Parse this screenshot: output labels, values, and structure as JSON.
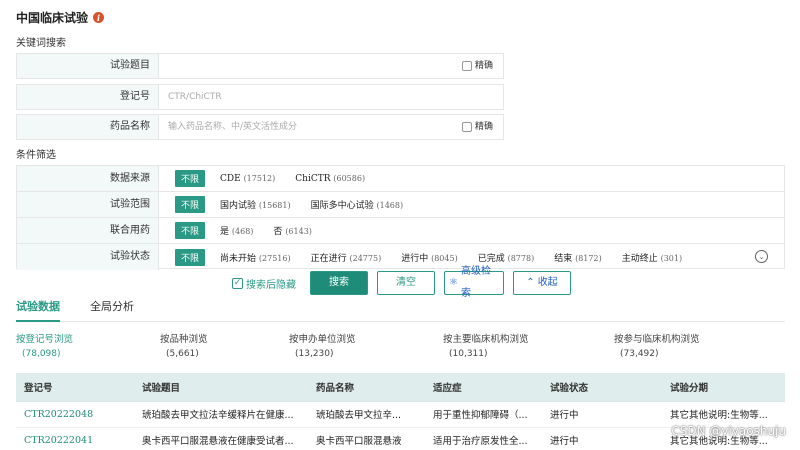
{
  "page": {
    "title": "中国临床试验",
    "info_icon": "i"
  },
  "keyword_section": {
    "label": "关键词搜索",
    "fields": [
      {
        "label": "试验题目",
        "placeholder": "",
        "precise_label": "精确"
      },
      {
        "label": "登记号",
        "placeholder": "CTR/ChiCTR"
      },
      {
        "label": "药品名称",
        "placeholder": "输入药品名称、中/英文活性成分",
        "precise_label": "精确"
      }
    ]
  },
  "filter_section": {
    "label": "条件筛选",
    "all_label": "不限",
    "rows": [
      {
        "label": "数据来源",
        "options": [
          {
            "name": "CDE",
            "count": "(17512)"
          },
          {
            "name": "ChiCTR",
            "count": "(60586)"
          }
        ]
      },
      {
        "label": "试验范围",
        "options": [
          {
            "name": "国内试验",
            "count": "(15681)"
          },
          {
            "name": "国际多中心试验",
            "count": "(1468)"
          }
        ]
      },
      {
        "label": "联合用药",
        "options": [
          {
            "name": "是",
            "count": "(468)"
          },
          {
            "name": "否",
            "count": "(6143)"
          }
        ]
      },
      {
        "label": "试验状态",
        "options": [
          {
            "name": "尚未开始",
            "count": "(27516)"
          },
          {
            "name": "正在进行",
            "count": "(24775)"
          },
          {
            "name": "进行中",
            "count": "(8045)"
          },
          {
            "name": "已完成",
            "count": "(8778)"
          },
          {
            "name": "结束",
            "count": "(8172)"
          },
          {
            "name": "主动终止",
            "count": "(301)"
          }
        ]
      }
    ]
  },
  "actions": {
    "hide_after_search": "搜索后隐藏",
    "search": "搜索",
    "clear": "清空",
    "advanced": "高级检索",
    "collapse": "收起"
  },
  "tabs": [
    "试验数据",
    "全局分析"
  ],
  "stats": [
    {
      "label": "按登记号浏览",
      "value": "(78,098)"
    },
    {
      "label": "按品种浏览",
      "value": "(5,661)"
    },
    {
      "label": "按申办单位浏览",
      "value": "(13,230)"
    },
    {
      "label": "按主要临床机构浏览",
      "value": "(10,311)"
    },
    {
      "label": "按参与临床机构浏览",
      "value": "(73,492)"
    }
  ],
  "table": {
    "columns": [
      "登记号",
      "试验题目",
      "药品名称",
      "适应症",
      "试验状态",
      "试验分期"
    ],
    "rows": [
      [
        "CTR20222048",
        "琥珀酸去甲文拉法辛缓释片在健康...",
        "琥珀酸去甲文拉辛...",
        "用于重性抑郁障碍（...",
        "进行中",
        "其它其他说明:生物等..."
      ],
      [
        "CTR20222041",
        "奥卡西平口服混悬液在健康受试者...",
        "奥卡西平口服混悬液",
        "适用于治疗原发性全...",
        "进行中",
        "其它其他说明:生物等..."
      ]
    ]
  },
  "watermark": "CSDN @yiyaoshuju",
  "colors": {
    "accent": "#2a9a86",
    "link_blue": "#2260c4",
    "label_bg": "#f3f8f8",
    "header_bg": "#dfeeec"
  }
}
